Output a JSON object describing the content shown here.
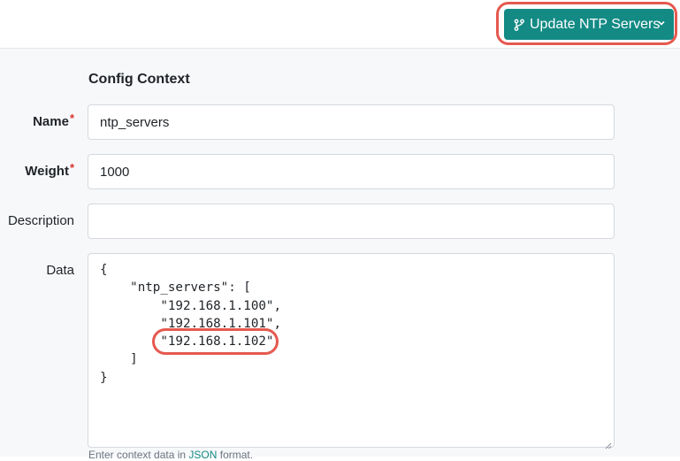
{
  "header": {
    "branch_button": {
      "label": "Update NTP Servers",
      "icon": "git-branch-icon",
      "dropdown_icon": "chevron-down-icon",
      "color": "#138a84"
    }
  },
  "form": {
    "section_title": "Config Context",
    "required_marker": "*",
    "fields": {
      "name": {
        "label": "Name",
        "value": "ntp_servers",
        "required": true
      },
      "weight": {
        "label": "Weight",
        "value": "1000",
        "required": true
      },
      "description": {
        "label": "Description",
        "value": ""
      },
      "data": {
        "label": "Data",
        "lines": [
          "{",
          "    \"ntp_servers\": [",
          "        \"192.168.1.100\",",
          "        \"192.168.1.101\",",
          "        \"192.168.1.102\"",
          "    ]",
          "}"
        ]
      }
    },
    "help": {
      "prefix": "Enter context data in ",
      "link": "JSON",
      "suffix": " format."
    }
  },
  "annotation_color": "#e5594f"
}
